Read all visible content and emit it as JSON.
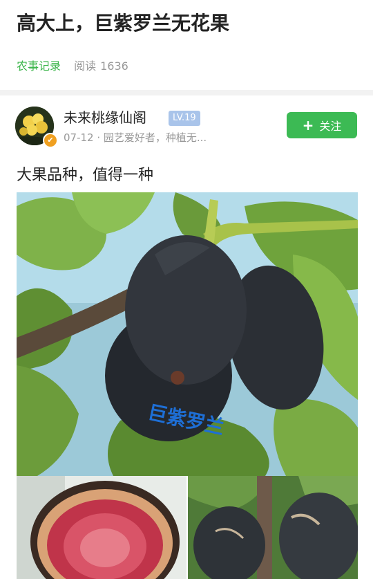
{
  "article": {
    "title": "高大上，巨紫罗兰无花果",
    "category": "农事记录",
    "reads_label": "阅读",
    "reads_count": "1636",
    "caption": "大果品种，值得一种"
  },
  "author": {
    "name": "未来桃缘仙阁",
    "level": "LV.19",
    "subtitle": "07-12 · 园艺爱好者，种植无..."
  },
  "actions": {
    "follow_label": "关注"
  },
  "photo": {
    "watermark": "巨紫罗兰"
  },
  "icons": {
    "follow": "plus-icon",
    "verified": "verified-badge-icon"
  },
  "colors": {
    "accent": "#3cba54",
    "level_badge": "#a9c4ea",
    "muted": "#999999"
  }
}
